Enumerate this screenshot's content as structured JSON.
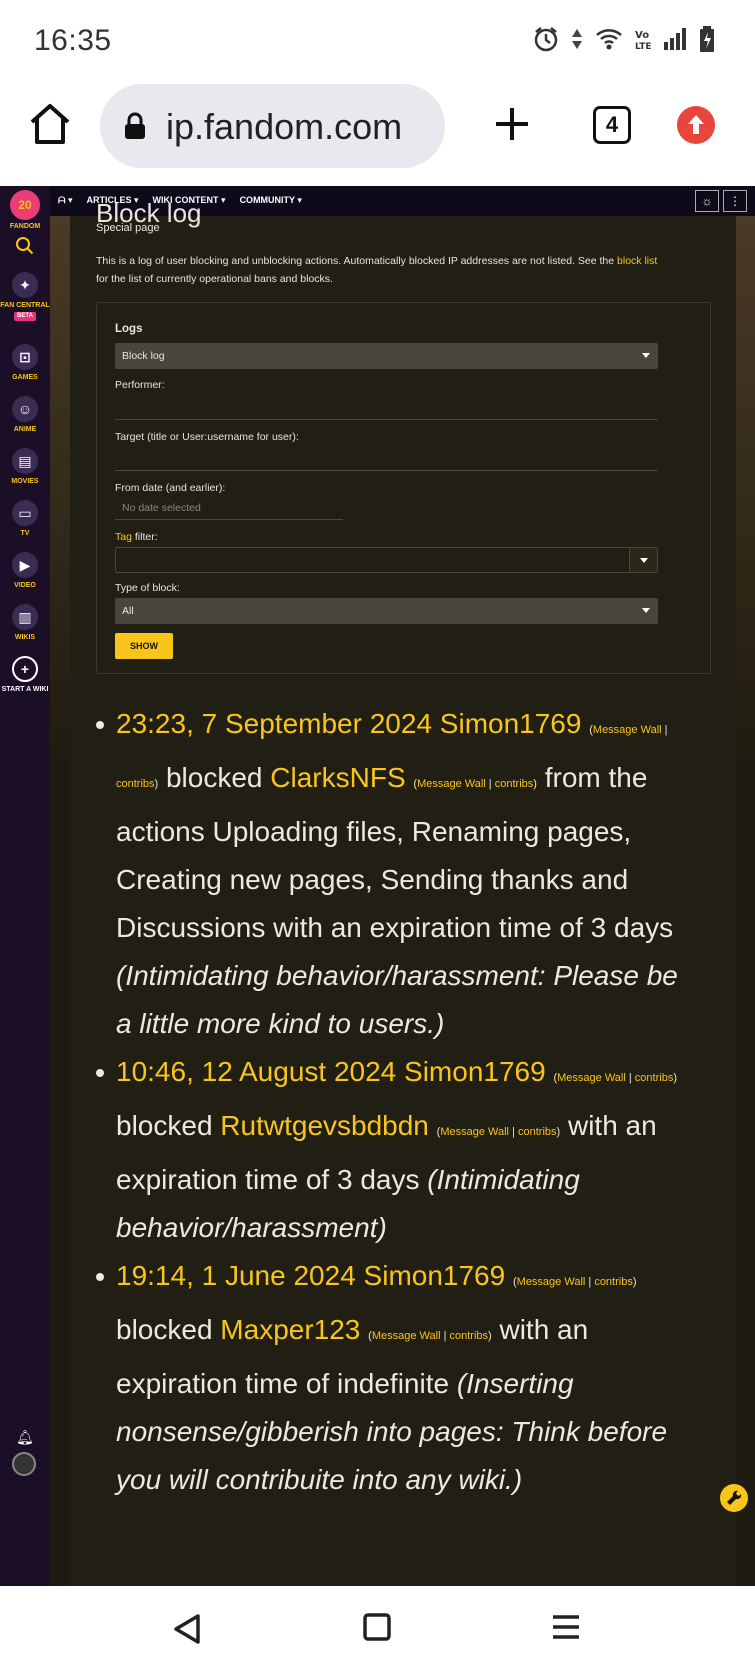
{
  "status_bar": {
    "time": "16:35",
    "icons": [
      "alarm-icon",
      "data-arrows-icon",
      "wifi-icon",
      "volte-icon",
      "signal-icon",
      "battery-icon"
    ]
  },
  "browser": {
    "url": "ip.fandom.com",
    "tab_count": "4",
    "icons": [
      "home-icon",
      "lock-icon",
      "plus-icon",
      "tabs-icon",
      "update-icon"
    ]
  },
  "fandom": {
    "logo_label": "20",
    "sidebar": [
      {
        "icon": "fandom-logo-icon",
        "label": "FANDOM"
      },
      {
        "icon": "search-icon",
        "label": ""
      },
      {
        "icon": "rocket-icon",
        "label": "FAN CENTRAL",
        "badge": "BETA"
      },
      {
        "icon": "controller-icon",
        "label": "GAMES"
      },
      {
        "icon": "anime-icon",
        "label": "ANIME"
      },
      {
        "icon": "clapperboard-icon",
        "label": "MOVIES"
      },
      {
        "icon": "tv-icon",
        "label": "TV"
      },
      {
        "icon": "play-icon",
        "label": "VIDEO"
      },
      {
        "icon": "book-icon",
        "label": "WIKIS"
      },
      {
        "icon": "plus-circle-icon",
        "label": "START A WIKI"
      }
    ],
    "topnav": [
      "ARTICLES",
      "WIKI CONTENT",
      "COMMUNITY"
    ]
  },
  "page": {
    "title": "Block log",
    "subtitle": "Special page",
    "intro_text": "This is a log of user blocking and unblocking actions. Automatically blocked IP addresses are not listed. See the ",
    "intro_link": "block list",
    "intro_end": "for the list of currently operational bans and blocks."
  },
  "form": {
    "logs_label": "Logs",
    "logs_value": "Block log",
    "performer_label": "Performer:",
    "target_label": "Target (title or User:username for user):",
    "from_date_label": "From date (and earlier):",
    "from_date_placeholder": "No date selected",
    "tag_link": "Tag",
    "tag_label": " filter:",
    "type_label": "Type of block:",
    "type_value": "All",
    "show_button": "SHOW"
  },
  "log_entries": [
    {
      "timestamp": "23:23, 7 September 2024",
      "performer": "Simon1769",
      "message_wall": "Message Wall",
      "contribs": "contribs",
      "action": " blocked ",
      "target": "ClarksNFS",
      "target_message_wall": "Message Wall",
      "target_contribs": "contribs",
      "detail": " from the actions Uploading files, Renaming pages, Creating new pages, Sending thanks and Discussions with an expiration time of 3 days ",
      "reason": "(Intimidating behavior/harassment: Please be a little more kind to users.)"
    },
    {
      "timestamp": "10:46, 12 August 2024",
      "performer": "Simon1769",
      "message_wall": "Message Wall",
      "contribs": "contribs",
      "action": " blocked ",
      "target": "Rutwtgevsbdbdn",
      "target_message_wall": "Message Wall",
      "target_contribs": "contribs",
      "detail": " with an expiration time of 3 days ",
      "reason": "(Intimidating behavior/harassment)"
    },
    {
      "timestamp": "19:14, 1 June 2024",
      "performer": "Simon1769",
      "message_wall": "Message Wall",
      "contribs": "contribs",
      "action": " blocked ",
      "target": "Maxper123",
      "target_message_wall": "Message Wall",
      "target_contribs": "contribs",
      "detail": " with an expiration time of indefinite ",
      "reason": "(Inserting nonsense/gibberish into pages: Think before you will contribuite into any wiki.)"
    }
  ],
  "nav_bar": {
    "icons": [
      "back-icon",
      "home-square-icon",
      "menu-icon"
    ]
  }
}
